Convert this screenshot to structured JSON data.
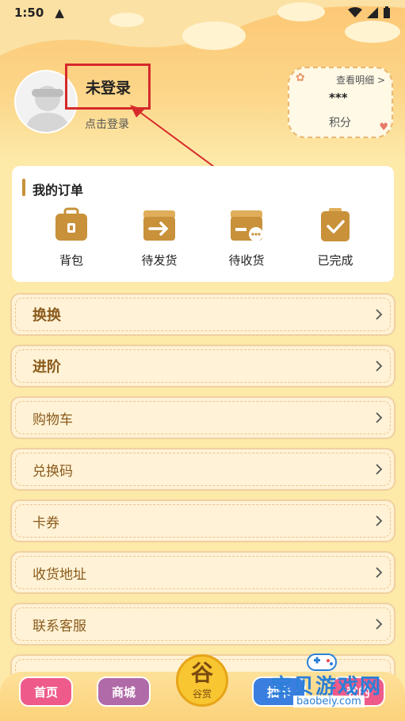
{
  "status_bar": {
    "time": "1:50",
    "warning": "▲"
  },
  "profile": {
    "title": "未登录",
    "subtitle": "点击登录"
  },
  "points": {
    "detail_label": "查看明细 >",
    "value": "***",
    "label": "积分"
  },
  "orders": {
    "title": "我的订单",
    "items": [
      {
        "label": "背包",
        "icon": "backpack-icon"
      },
      {
        "label": "待发货",
        "icon": "ship-icon"
      },
      {
        "label": "待收货",
        "icon": "receive-icon"
      },
      {
        "label": "已完成",
        "icon": "completed-icon"
      }
    ]
  },
  "menu": {
    "items": [
      {
        "label": "换换"
      },
      {
        "label": "进阶"
      },
      {
        "label": "购物车"
      },
      {
        "label": "兑换码"
      },
      {
        "label": "卡券"
      },
      {
        "label": "收货地址"
      },
      {
        "label": "联系客服"
      }
    ]
  },
  "bottom_nav": {
    "home": "首页",
    "mall": "商城",
    "center_big": "谷",
    "center_small": "谷赏",
    "draw": "抽卡",
    "mine": "我的"
  },
  "watermark": {
    "text": "宝贝游戏网",
    "url": "baobeiy.com"
  },
  "colors": {
    "accent_brown": "#c8913a",
    "menu_text": "#8a5a1c",
    "highlight_red": "#d62a2a",
    "nav_pink": "#ee5b8a",
    "nav_purple": "#b06aa8",
    "nav_blue": "#3a7fe0"
  }
}
